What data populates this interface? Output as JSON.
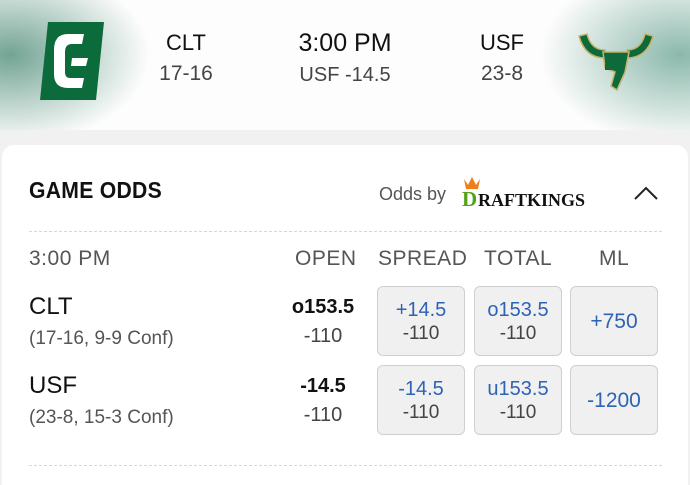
{
  "header": {
    "away": {
      "abbr": "CLT",
      "record": "17-16"
    },
    "home": {
      "abbr": "USF",
      "record": "23-8"
    },
    "time": "3:00 PM",
    "line": "USF -14.5"
  },
  "odds": {
    "title": "GAME ODDS",
    "odds_by": "Odds by",
    "provider": "DRAFTKINGS",
    "columns": {
      "time": "3:00 PM",
      "open": "OPEN",
      "spread": "SPREAD",
      "total": "TOTAL",
      "ml": "ML"
    },
    "rows": [
      {
        "team": "CLT",
        "detail": "(17-16, 9-9 Conf)",
        "open_top": "o153.5",
        "open_bot": "-110",
        "spread": "+14.5",
        "spread_odds": "-110",
        "total": "o153.5",
        "total_odds": "-110",
        "ml": "+750"
      },
      {
        "team": "USF",
        "detail": "(23-8, 15-3 Conf)",
        "open_top": "-14.5",
        "open_bot": "-110",
        "spread": "-14.5",
        "spread_odds": "-110",
        "total": "u153.5",
        "total_odds": "-110",
        "ml": "-1200"
      }
    ]
  },
  "colors": {
    "link_blue": "#2e62b5",
    "clt_green": "#0b6b3a",
    "usf_green": "#0d6b3b",
    "dk_green": "#53a318",
    "dk_orange": "#f07c1a"
  }
}
